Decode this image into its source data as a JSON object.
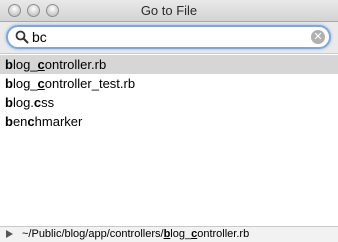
{
  "window": {
    "title": "Go to File"
  },
  "search": {
    "value": "bc"
  },
  "results": [
    {
      "pre": "",
      "m1": "b",
      "mid": "log_",
      "m2": "c",
      "post": "ontroller.rb"
    },
    {
      "pre": "",
      "m1": "b",
      "mid": "log_",
      "m2": "c",
      "post": "ontroller_test.rb"
    },
    {
      "pre": "",
      "m1": "b",
      "mid": "log.",
      "m2": "c",
      "post": "ss"
    },
    {
      "pre": "",
      "m1": "b",
      "mid": "en",
      "m2": "c",
      "post": "hmarker"
    }
  ],
  "selected_index": 0,
  "footer": {
    "path_prefix": "~/Public/blog/app/controllers/",
    "m1": "b",
    "mid": "log_",
    "m2": "c",
    "post": "ontroller.rb"
  },
  "colors": {
    "selection": "#d6d6d6",
    "focus_ring": "#7fa8d8"
  },
  "icons": {
    "search": "search-icon",
    "clear": "clear-icon",
    "disclosure": "disclosure-triangle-icon"
  }
}
